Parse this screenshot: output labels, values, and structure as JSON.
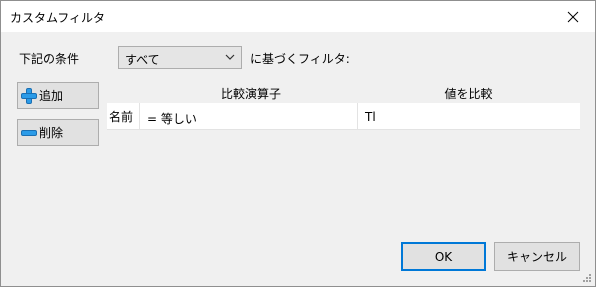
{
  "window": {
    "title": "カスタムフィルタ"
  },
  "icons": {
    "close": "close-icon",
    "add": "plus-icon",
    "remove": "minus-icon",
    "dropdown": "chevron-down-icon",
    "grip": "resize-grip-icon"
  },
  "colors": {
    "accent": "#0078d7",
    "add_icon": "#2b9be8",
    "remove_icon": "#2b9be8"
  },
  "condition": {
    "prefix_label": "下記の条件",
    "selected": "すべて",
    "suffix_label": "に基づくフィルタ:"
  },
  "side_buttons": {
    "add_label": "追加",
    "remove_label": "削除"
  },
  "table": {
    "headers": [
      "比較演算子",
      "値を比較"
    ],
    "row": {
      "field": "名前",
      "operator": "= 等しい",
      "value": "Tl"
    }
  },
  "footer": {
    "ok_label": "OK",
    "cancel_label": "キャンセル"
  }
}
